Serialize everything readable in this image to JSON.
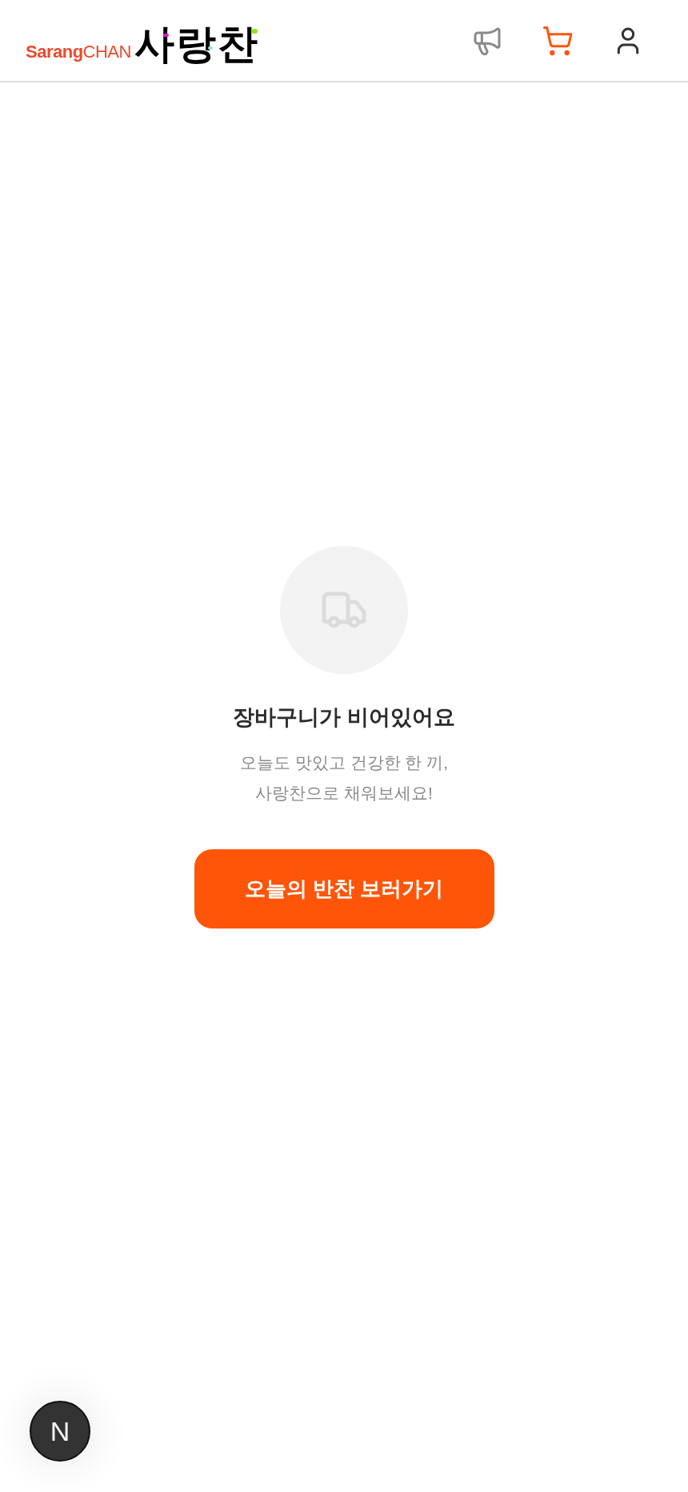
{
  "header": {
    "logo": {
      "latin": "**Sarang**CHAN",
      "korean": "사랑찬"
    },
    "nav": [
      {
        "kind": "notice",
        "selected": false
      },
      {
        "kind": "cart",
        "selected": true
      },
      {
        "kind": "account",
        "selected": false
      }
    ]
  },
  "empty_cart": {
    "title": "장바구니가 비어있어요",
    "message": "오늘도 맛있고 건강한 한 끼,\n사랑찬으로 채워보세요!",
    "button": "오늘의 반찬 보러가기"
  },
  "dev_badge": {
    "label": "N"
  }
}
